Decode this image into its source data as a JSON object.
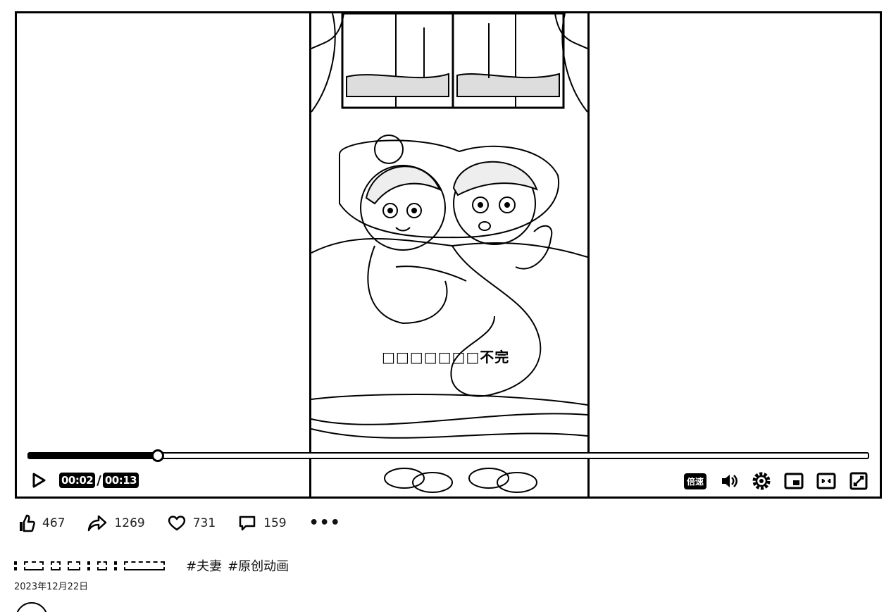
{
  "player": {
    "subtitle": "□□□□□□□不完",
    "progress": {
      "fraction": 0.1538
    },
    "time": {
      "current": "00:02",
      "separator": "/",
      "total": "00:13"
    },
    "speed_label": "倍速",
    "icons": {
      "play": "play-icon",
      "volume": "volume-icon",
      "settings": "gear-icon",
      "pip": "picture-in-picture-icon",
      "widescreen": "widescreen-icon",
      "fullscreen": "fullscreen-icon"
    }
  },
  "actions": {
    "like": {
      "icon": "thumbs-up-icon",
      "count": "467"
    },
    "share": {
      "icon": "share-arrow-icon",
      "count": "1269"
    },
    "favorite": {
      "icon": "heart-icon",
      "count": "731"
    },
    "comment": {
      "icon": "comment-icon",
      "count": "159"
    },
    "more": {
      "icon": "more-dots-icon",
      "label": "•••"
    }
  },
  "post": {
    "tags": [
      "#夫妻",
      "#原创动画"
    ],
    "date": "2023年12月22日"
  },
  "colors": {
    "ink": "#000000",
    "background": "#ffffff"
  }
}
